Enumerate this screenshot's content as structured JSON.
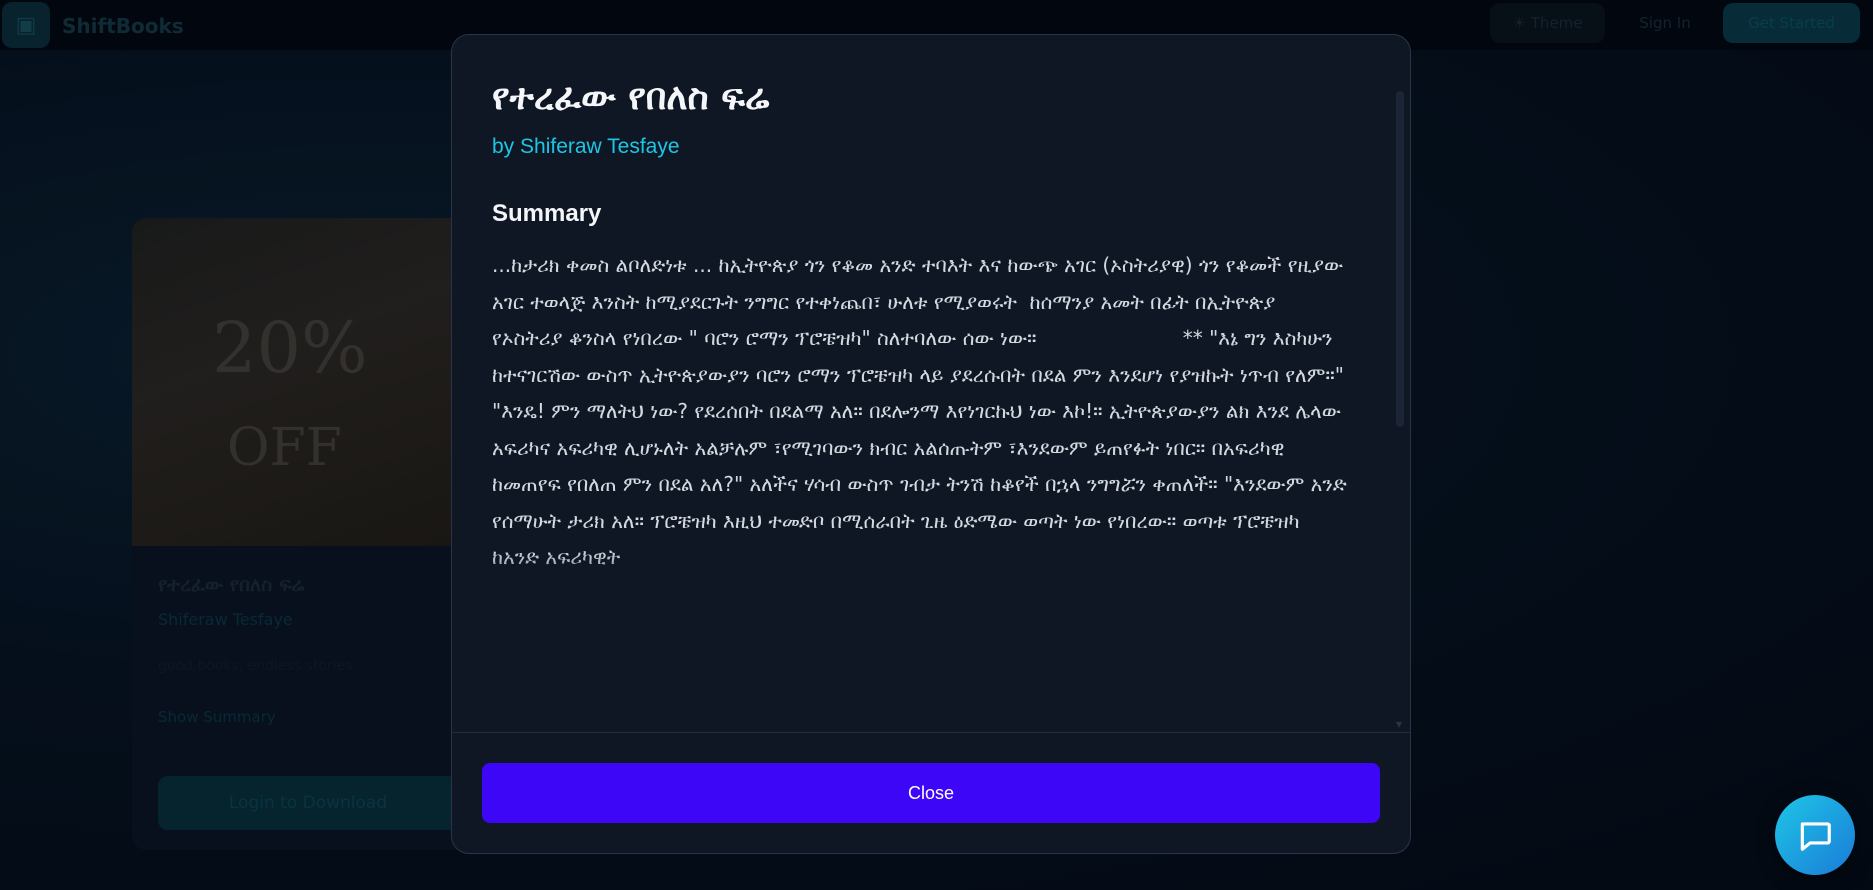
{
  "nav": {
    "logo_text": "ShiftBooks",
    "theme_label": "☀ Theme",
    "signin_label": "Sign In",
    "get_started_label": "Get Started"
  },
  "background_card": {
    "cover_promo": "20%",
    "cover_promo2": "OFF",
    "title": "የተረፈው የበለስ ፍሬ",
    "author": "Shiferaw Tesfaye",
    "description": "good books, endless stories",
    "link_label": "Show Summary",
    "button_label": "Login to Download"
  },
  "modal": {
    "title": "የተረፈው የበለስ ፍሬ",
    "author": "by Shiferaw Tesfaye",
    "summary_heading": "Summary",
    "summary_text": "...ከታሪክ ቀመስ ልቦለድነቱ ... ከኢትዮጵያ ጎን የቆመ አንድ ተባእት እና ከውጭ አገር (ኦስትሪያዊ) ጎን የቆመች የዚያው አገር ተወላጅ እንስት ከሚያደርጉት ንግግር የተቀነጨበ፣ ሁለቱ የሚያወሩት  ከሰማንያ አመት በፊት በኢትዮጵያ የኦስትሪያ ቆንስላ የነበረው \" ባሮን ሮማን ፕሮቼዝካ\" ስለተባለው ሰው ነው።                       ** \"እኔ ግን እስካሁን ከተናገርሽው ውስጥ ኢትዮጵያውያን ባሮን ሮማን ፕሮቼዝካ ላይ ያደረሱበት በደል ምን እንደሆነ የያዝኩት ነጥብ የለም።\" \"እንዴ! ምን ማለትህ ነው? የደረሰበት በደልማ አለ። በደሎንማ እየነገርኩህ ነው እኮ!። ኢትዮጵያውያን ልክ እንደ ሌላው አፍሪካና አፍሪካዊ ሊሆኑለት አልቻሉም ፣የሚገባውን ክብር አልሰጡትም ፣እንደውም ይጠየፉት ነበር። በአፍሪካዊ ከመጠየፍ የበለጠ ምን በደል አለ?\" አለችና ሃሳብ ውስጥ ገብታ ትንሽ ከቆየች በኋላ ንግግሯን ቀጠለች። \"እንደውም አንድ የሰማሁት ታሪክ አለ። ፕሮቼዝካ እዚህ ተመድቦ በሚሰራበት ጊዜ ዕድሜው ወጣት ነው የነበረው። ወጣቱ ፕሮቼዝካ ከአንድ አፍሪካዊት",
    "close_label": "Close"
  },
  "colors": {
    "accent_cyan": "#1ec6e6",
    "close_button": "#3d06f6",
    "modal_bg": "#0f1725"
  },
  "icons": {
    "chat": "chat-bubble-icon"
  }
}
